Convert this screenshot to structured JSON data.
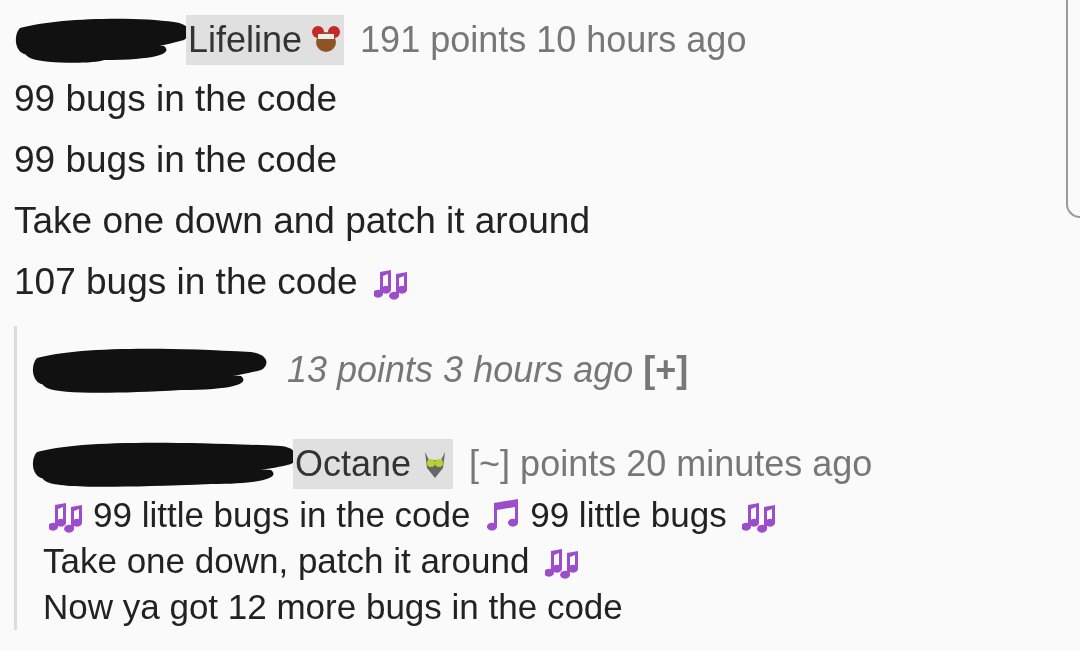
{
  "comments": [
    {
      "author_redacted": true,
      "flair": {
        "text": "Lifeline",
        "kind": "red"
      },
      "score": "191 points",
      "time": "10 hours ago",
      "collapsed": false,
      "body": [
        [
          {
            "kind": "text",
            "text": "99 bugs in the code"
          }
        ],
        [
          {
            "kind": "text",
            "text": "99 bugs in the code"
          }
        ],
        [
          {
            "kind": "text",
            "text": "Take one down and patch it around"
          }
        ],
        [
          {
            "kind": "text",
            "text": "107 bugs in the code"
          },
          {
            "kind": "notes"
          }
        ]
      ],
      "replies": [
        {
          "author_redacted": true,
          "score": "13 points",
          "time": "3 hours ago",
          "collapsed": true,
          "toggle": "[+]"
        },
        {
          "author_redacted": true,
          "flair": {
            "text": "Octane",
            "kind": "green"
          },
          "score": "[~] points",
          "time": "20 minutes ago",
          "collapsed": false,
          "body": [
            [
              {
                "kind": "notes"
              },
              {
                "kind": "text",
                "text": "99 little bugs in the code"
              },
              {
                "kind": "note"
              },
              {
                "kind": "text",
                "text": "99 little bugs"
              },
              {
                "kind": "notes"
              },
              {
                "kind": "text",
                "text": "Take one down, patch it around"
              },
              {
                "kind": "notes"
              },
              {
                "kind": "text",
                "text": "Now ya got 12 more bugs in the code"
              }
            ]
          ]
        }
      ]
    }
  ]
}
